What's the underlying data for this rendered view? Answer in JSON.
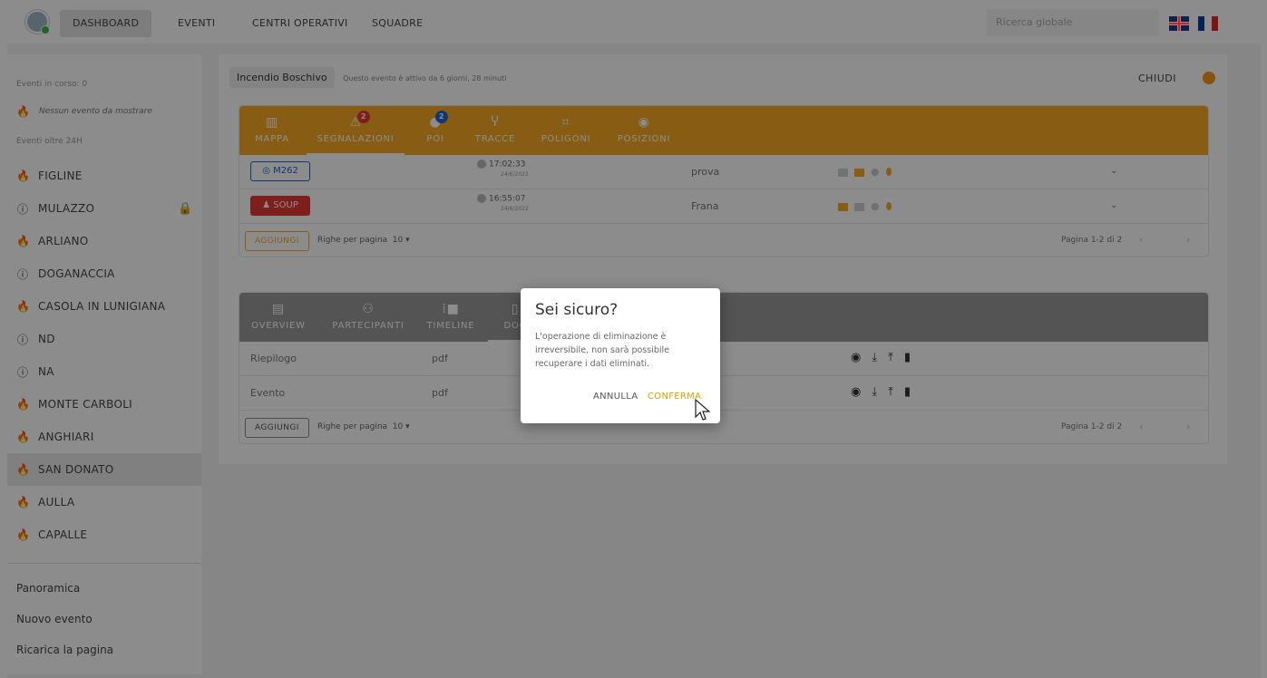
{
  "topnav": {
    "tabs": [
      "DASHBOARD",
      "EVENTI",
      "CENTRI OPERATIVI",
      "SQUADRE"
    ],
    "search_placeholder": "Ricerca globale",
    "languages": [
      "en",
      "fr"
    ]
  },
  "sidebar": {
    "ongoing_label": "Eventi in corso: 0",
    "empty_message": "Nessun evento da mostrare",
    "over24_label": "Eventi oltre 24H",
    "events": [
      {
        "name": "FIGLINE",
        "icon": "fire-icon"
      },
      {
        "name": "MULAZZO",
        "icon": "alert-icon",
        "locked": true
      },
      {
        "name": "ARLIANO",
        "icon": "fire-icon"
      },
      {
        "name": "DOGANACCIA",
        "icon": "alert-icon"
      },
      {
        "name": "CASOLA IN LUNIGIANA",
        "icon": "fire-icon"
      },
      {
        "name": "ND",
        "icon": "alert-icon"
      },
      {
        "name": "NA",
        "icon": "alert-icon"
      },
      {
        "name": "MONTE CARBOLI",
        "icon": "fire-icon"
      },
      {
        "name": "ANGHIARI",
        "icon": "fire-icon"
      },
      {
        "name": "SAN DONATO",
        "icon": "fire-icon",
        "selected": true
      },
      {
        "name": "AULLA",
        "icon": "fire-icon"
      },
      {
        "name": "CAPALLE",
        "icon": "fire-icon"
      }
    ],
    "links": [
      "Panoramica",
      "Nuovo evento",
      "Ricarica la pagina"
    ]
  },
  "event": {
    "type": "Incendio Boschivo",
    "active_since": "Questo evento è attivo da 6 giorni, 28 minuti",
    "close_label": "CHIUDI",
    "status_color": "#f7941d"
  },
  "panel1": {
    "tabs": [
      {
        "label": "MAPPA",
        "icon": "map-icon"
      },
      {
        "label": "SEGNALAZIONI",
        "icon": "warning-icon",
        "badge": "2",
        "active": true
      },
      {
        "label": "POI",
        "icon": "pin-icon",
        "badge": "2"
      },
      {
        "label": "TRACCE",
        "icon": "route-icon"
      },
      {
        "label": "POLIGONI",
        "icon": "polygon-icon"
      },
      {
        "label": "POSIZIONI",
        "icon": "target-icon"
      }
    ],
    "rows": [
      {
        "code": "M262",
        "time": "17:02:33",
        "date": "24/6/2022",
        "description": "prova"
      },
      {
        "code": "SOUP",
        "time": "16:55:07",
        "date": "24/6/2022",
        "description": "Frana"
      }
    ],
    "add_label": "AGGIUNGI",
    "rows_per_page": "Righe per pagina",
    "rows_per_page_value": "10",
    "page_info": "Pagina 1-2 di 2"
  },
  "panel2": {
    "tabs": [
      {
        "label": "OVERVIEW",
        "icon": "overview-icon"
      },
      {
        "label": "PARTECIPANTI",
        "icon": "people-icon"
      },
      {
        "label": "TIMELINE",
        "icon": "timeline-icon"
      },
      {
        "label": "DOC",
        "icon": "doc-icon",
        "active": true
      }
    ],
    "rows": [
      {
        "name": "Riepilogo",
        "type": "pdf"
      },
      {
        "name": "Evento",
        "type": "pdf"
      }
    ],
    "add_label": "AGGIUNGI",
    "rows_per_page": "Righe per pagina",
    "rows_per_page_value": "10",
    "page_info": "Pagina 1-2 di 2"
  },
  "dialog": {
    "title": "Sei sicuro?",
    "message": "L'operazione di eliminazione è irreversibile, non sarà possibile recuperare i dati eliminati.",
    "cancel_label": "ANNULLA",
    "confirm_label": "CONFERMA"
  },
  "colors": {
    "accent_orange": "#f7a823",
    "danger_red": "#e53935",
    "primary_blue": "#1e63d6"
  }
}
